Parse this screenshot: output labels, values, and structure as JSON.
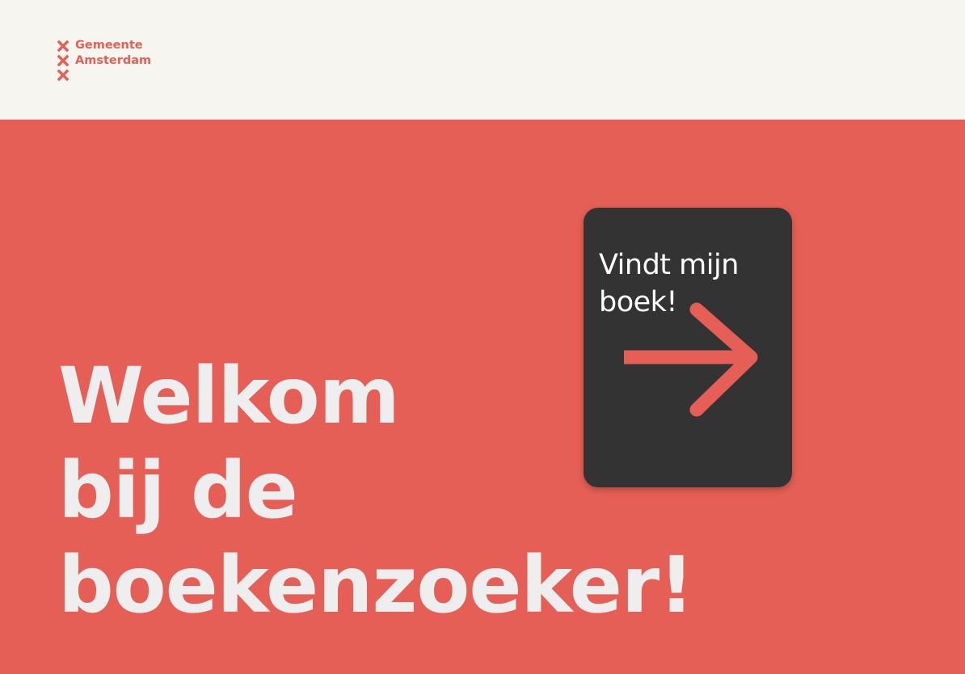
{
  "brand": {
    "logo_lines": [
      "Gemeente",
      "Amsterdam"
    ],
    "logo_icon": "amsterdam-cross-icon",
    "primary_color": "#e55f56",
    "header_color": "#f6f5ef",
    "text_light_color": "#eeeeee",
    "card_color": "#333333"
  },
  "hero": {
    "title_lines": [
      "Welkom",
      "bij de",
      "boekenzoeker!"
    ]
  },
  "cta": {
    "label": "Vindt mijn boek!",
    "icon": "arrow-right-icon"
  }
}
